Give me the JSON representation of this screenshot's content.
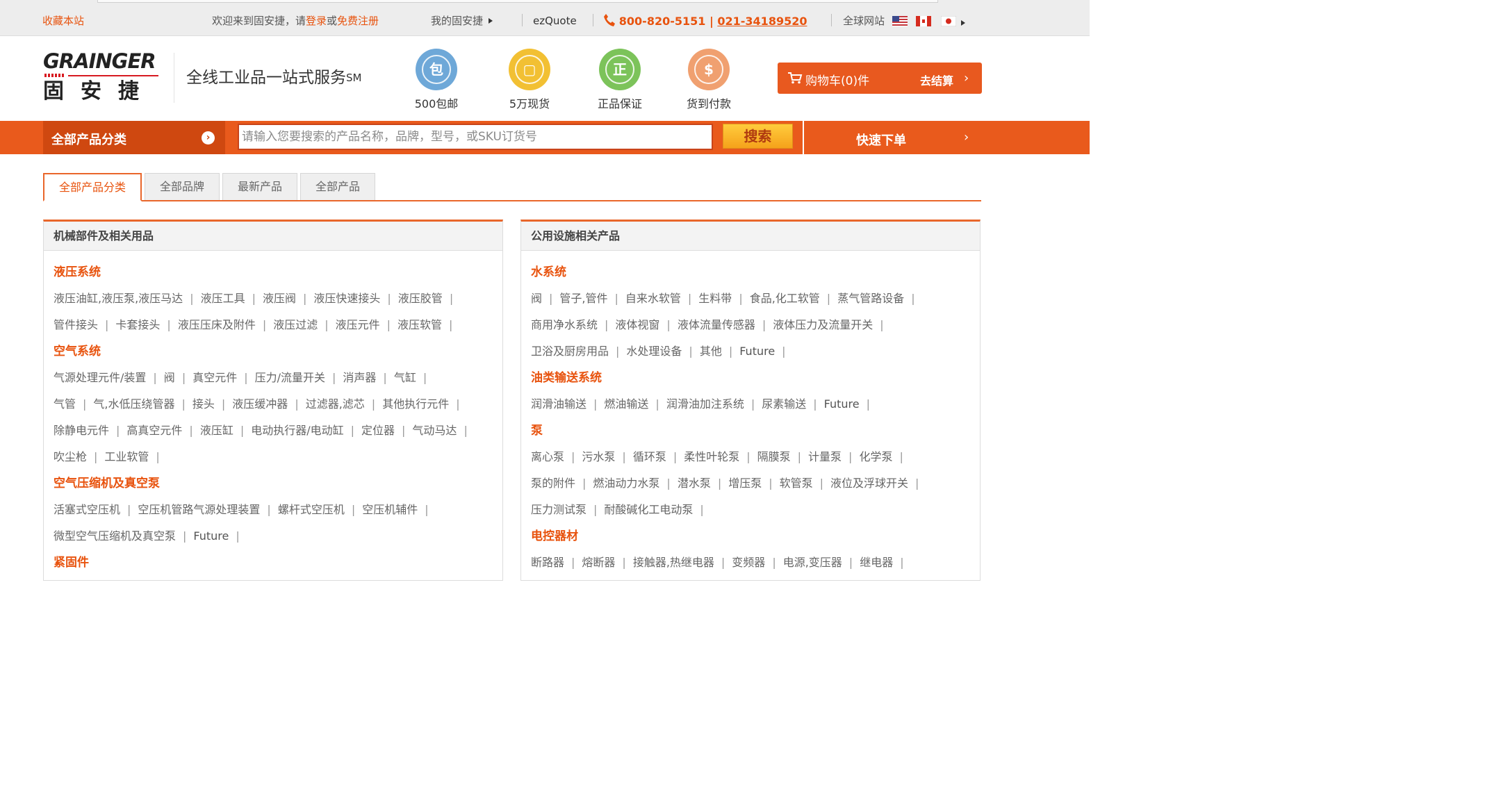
{
  "topbar": {
    "bookmark": "收藏本站",
    "welcome": "欢迎来到固安捷，请",
    "login": "登录",
    "or": "或",
    "register": "免费注册",
    "my_account": "我的固安捷",
    "ezquote": "ezQuote",
    "phone1": "800-820-5151",
    "phone_sep": " | ",
    "phone2": "021-34189520",
    "global_site": "全球网站"
  },
  "header": {
    "logo_text": "GRAINGER",
    "logo_cn": "固安捷",
    "slogan": "全线工业品一站式服务",
    "slogan_mark": "SM",
    "badges": [
      {
        "glyph": "包",
        "label": "500包邮",
        "color": "#6ea8d8"
      },
      {
        "glyph": "▢",
        "label": "5万现货",
        "color": "#f2c033"
      },
      {
        "glyph": "正",
        "label": "正品保证",
        "color": "#7cc35a"
      },
      {
        "glyph": "$",
        "label": "货到付款",
        "color": "#f0a070"
      }
    ],
    "cart_label": "购物车(0)件",
    "checkout_label": "去结算",
    "brand_color": "#e8591f"
  },
  "nav": {
    "all_categories": "全部产品分类",
    "search_placeholder": "请输入您要搜索的产品名称，品牌，型号，或SKU订货号",
    "search_button": "搜索",
    "quick_order": "快速下单"
  },
  "tabs": [
    "全部产品分类",
    "全部品牌",
    "最新产品",
    "全部产品"
  ],
  "left_panel": {
    "title": "机械部件及相关用品",
    "sections": [
      {
        "title": "液压系统",
        "rows": [
          [
            "液压油缸,液压泵,液压马达",
            "液压工具",
            "液压阀",
            "液压快速接头",
            "液压胶管"
          ],
          [
            "管件接头",
            "卡套接头",
            "液压压床及附件",
            "液压过滤",
            "液压元件",
            "液压软管"
          ]
        ]
      },
      {
        "title": "空气系统",
        "rows": [
          [
            "气源处理元件/装置",
            "阀",
            "真空元件",
            "压力/流量开关",
            "消声器",
            "气缸"
          ],
          [
            "气管",
            "气,水低压绕管器",
            "接头",
            "液压缓冲器",
            "过滤器,滤芯",
            "其他执行元件"
          ],
          [
            "除静电元件",
            "高真空元件",
            "液压缸",
            "电动执行器/电动缸",
            "定位器",
            "气动马达"
          ],
          [
            "吹尘枪",
            "工业软管"
          ]
        ]
      },
      {
        "title": "空气压缩机及真空泵",
        "rows": [
          [
            "活塞式空压机",
            "空压机管路气源处理装置",
            "螺杆式空压机",
            "空压机辅件"
          ],
          [
            "微型空气压缩机及真空泵",
            "Future"
          ]
        ]
      },
      {
        "title": "紧固件",
        "rows": []
      }
    ]
  },
  "right_panel": {
    "title": "公用设施相关产品",
    "sections": [
      {
        "title": "水系统",
        "rows": [
          [
            "阀",
            "管子,管件",
            "自来水软管",
            "生料带",
            "食品,化工软管",
            "蒸气管路设备"
          ],
          [
            "商用净水系统",
            "液体视窗",
            "液体流量传感器",
            "液体压力及流量开关"
          ],
          [
            "卫浴及厨房用品",
            "水处理设备",
            "其他",
            "Future"
          ]
        ]
      },
      {
        "title": "油类输送系统",
        "rows": [
          [
            "润滑油输送",
            "燃油输送",
            "润滑油加注系统",
            "尿素输送",
            "Future"
          ]
        ]
      },
      {
        "title": "泵",
        "rows": [
          [
            "离心泵",
            "污水泵",
            "循环泵",
            "柔性叶轮泵",
            "隔膜泵",
            "计量泵",
            "化学泵"
          ],
          [
            "泵的附件",
            "燃油动力水泵",
            "潜水泵",
            "增压泵",
            "软管泵",
            "液位及浮球开关"
          ],
          [
            "压力测试泵",
            "耐酸碱化工电动泵"
          ]
        ]
      },
      {
        "title": "电控器材",
        "rows": [
          [
            "断路器",
            "熔断器",
            "接触器,热继电器",
            "变频器",
            "电源,变压器",
            "继电器"
          ]
        ]
      }
    ]
  }
}
